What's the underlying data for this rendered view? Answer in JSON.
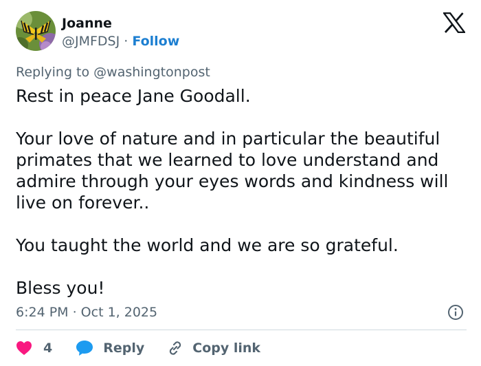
{
  "author": {
    "name": "Joanne",
    "handle": "@JMFDSJ",
    "separator": " · ",
    "follow_label": "Follow"
  },
  "reply_context": {
    "prefix": "Replying to ",
    "mention": "@washingtonpost"
  },
  "tweet": {
    "paragraphs": [
      "Rest in peace Jane Goodall.",
      "Your love of nature and in particular the beautiful primates that we learned to love understand and admire through your eyes words and kindness will live on forever..",
      "You taught the world and we are so grateful.",
      "Bless you!"
    ],
    "timestamp": "6:24 PM · Oct 1, 2025"
  },
  "actions": {
    "like_count": "4",
    "reply_label": "Reply",
    "copy_link_label": "Copy link"
  },
  "colors": {
    "accent": "#1d7fd1",
    "like": "#f91880",
    "reply_bubble": "#1d9bf0",
    "muted_text": "#536471",
    "divider": "#cfd9de"
  },
  "icons": {
    "brand": "x-logo-icon",
    "info": "info-icon",
    "like": "heart-icon",
    "reply": "speech-bubble-icon",
    "copy": "link-icon"
  }
}
